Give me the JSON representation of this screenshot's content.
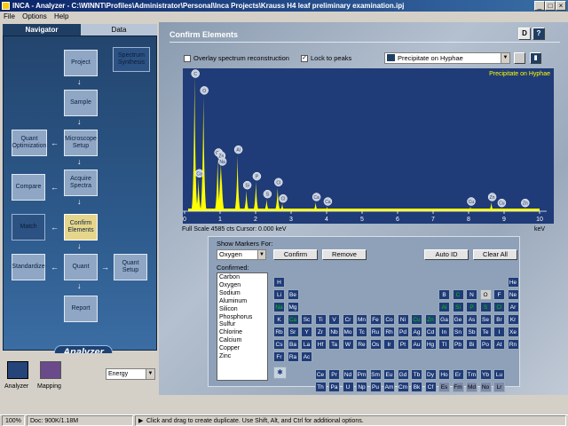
{
  "window": {
    "title": "INCA - Analyzer - C:\\WINNT\\Profiles\\Administrator\\Personal\\Inca Projects\\Krauss H4 leaf preliminary examination.ipj",
    "btns": [
      "_",
      "□",
      "×"
    ]
  },
  "menu": [
    "File",
    "Options",
    "Help"
  ],
  "tabs": {
    "navigator": "Navigator",
    "data": "Data"
  },
  "nav": {
    "project": "Project",
    "spectrum_synthesis": "Spectrum Synthesis",
    "sample": "Sample",
    "quant_optimization": "Quant Optimization",
    "microscope_setup": "Microscope Setup",
    "compare": "Compare",
    "acquire_spectra": "Acquire Spectra",
    "match": "Match",
    "confirm_elements": "Confirm Elements",
    "standardize": "Standardize",
    "quant": "Quant",
    "quant_setup": "Quant Setup",
    "report": "Report",
    "logo": "Analyzer"
  },
  "bottom": {
    "analyzer": "Analyzer",
    "mapping": "Mapping",
    "energy": "Energy"
  },
  "main": {
    "title": "Confirm Elements",
    "overlay": "Overlay spectrum reconstruction",
    "lock": "Lock to peaks",
    "spectrum_name": "Precipitate on Hyphae",
    "info": "Full Scale  4585 cts  Cursor: 0.000 keV",
    "kev": "keV"
  },
  "chart_data": {
    "type": "line",
    "title": "Precipitate on Hyphae",
    "xlabel": "keV",
    "xlim": [
      0,
      10
    ],
    "x_ticks": [
      0,
      1,
      2,
      3,
      4,
      5,
      6,
      7,
      8,
      9,
      10
    ],
    "ylim": [
      0,
      4585
    ],
    "peaks": [
      {
        "x": 0.28,
        "y": 4585,
        "label": "C"
      },
      {
        "x": 0.39,
        "y": 1100,
        "label": "Ca"
      },
      {
        "x": 0.53,
        "y": 3900,
        "label": "O"
      },
      {
        "x": 0.93,
        "y": 1800,
        "label": "Cu"
      },
      {
        "x": 1.01,
        "y": 1700,
        "label": "Zn"
      },
      {
        "x": 1.04,
        "y": 1500,
        "label": "Na"
      },
      {
        "x": 1.49,
        "y": 1900,
        "label": "Al"
      },
      {
        "x": 1.74,
        "y": 700,
        "label": "Si"
      },
      {
        "x": 2.01,
        "y": 1000,
        "label": "P"
      },
      {
        "x": 2.31,
        "y": 400,
        "label": "S"
      },
      {
        "x": 2.62,
        "y": 800,
        "label": "Cl"
      },
      {
        "x": 2.75,
        "y": 250,
        "label": "Cl"
      },
      {
        "x": 3.69,
        "y": 300,
        "label": "Ca"
      },
      {
        "x": 4.01,
        "y": 150,
        "label": "Ca"
      },
      {
        "x": 8.05,
        "y": 150,
        "label": "Cu"
      },
      {
        "x": 8.64,
        "y": 300,
        "label": "Zn"
      },
      {
        "x": 8.91,
        "y": 100,
        "label": "Cu"
      },
      {
        "x": 9.57,
        "y": 100,
        "label": "Zn"
      }
    ]
  },
  "markers": {
    "show_label": "Show Markers For:",
    "element": "Oxygen",
    "confirm": "Confirm",
    "remove": "Remove",
    "autoid": "Auto ID",
    "clear": "Clear All",
    "confirmed_label": "Confirmed:",
    "confirmed": [
      "Carbon",
      "Oxygen",
      "Sodium",
      "Aluminum",
      "Silicon",
      "Phosphorus",
      "Sulfur",
      "Chlorine",
      "Calcium",
      "Copper",
      "Zinc"
    ]
  },
  "periodic": {
    "rows": [
      [
        "H",
        "",
        "",
        "",
        "",
        "",
        "",
        "",
        "",
        "",
        "",
        "",
        "",
        "",
        "",
        "",
        "",
        "He"
      ],
      [
        "Li",
        "Be",
        "",
        "",
        "",
        "",
        "",
        "",
        "",
        "",
        "",
        "",
        "B",
        "C",
        "N",
        "O",
        "F",
        "Ne"
      ],
      [
        "Na",
        "Mg",
        "",
        "",
        "",
        "",
        "",
        "",
        "",
        "",
        "",
        "",
        "Al",
        "Si",
        "P",
        "S",
        "Cl",
        "Ar"
      ],
      [
        "K",
        "Ca",
        "Sc",
        "Ti",
        "V",
        "Cr",
        "Mn",
        "Fe",
        "Co",
        "Ni",
        "Cu",
        "Zn",
        "Ga",
        "Ge",
        "As",
        "Se",
        "Br",
        "Kr"
      ],
      [
        "Rb",
        "Sr",
        "Y",
        "Zr",
        "Nb",
        "Mo",
        "Tc",
        "Ru",
        "Rh",
        "Pd",
        "Ag",
        "Cd",
        "In",
        "Sn",
        "Sb",
        "Te",
        "I",
        "Xe"
      ],
      [
        "Cs",
        "Ba",
        "La",
        "Hf",
        "Ta",
        "W",
        "Re",
        "Os",
        "Ir",
        "Pt",
        "Au",
        "Hg",
        "Tl",
        "Pb",
        "Bi",
        "Po",
        "At",
        "Rn"
      ],
      [
        "Fr",
        "Ra",
        "Ac",
        "",
        "",
        "",
        "",
        "",
        "",
        "",
        "",
        "",
        "",
        "",
        "",
        "",
        "",
        ""
      ]
    ],
    "lanth": [
      "Ce",
      "Pr",
      "Nd",
      "Pm",
      "Sm",
      "Eu",
      "Gd",
      "Tb",
      "Dy",
      "Ho",
      "Er",
      "Tm",
      "Yb",
      "Lu"
    ],
    "actin": [
      "Th",
      "Pa",
      "U",
      "Np",
      "Pu",
      "Am",
      "Cm",
      "Bk",
      "Cf",
      "Es",
      "Fm",
      "Md",
      "No",
      "Lr"
    ],
    "confirmed_symbols": [
      "C",
      "O",
      "Na",
      "Al",
      "Si",
      "P",
      "S",
      "Cl",
      "Ca",
      "Cu",
      "Zn"
    ],
    "selected": "O",
    "inactive": [
      "Es",
      "Fm",
      "Md",
      "No",
      "Lr"
    ]
  },
  "status": {
    "zoom": "100%",
    "doc": "Doc: 900K/1.18M",
    "hint": "Click and drag to create duplicate. Use Shift, Alt, and Ctrl for additional options."
  }
}
